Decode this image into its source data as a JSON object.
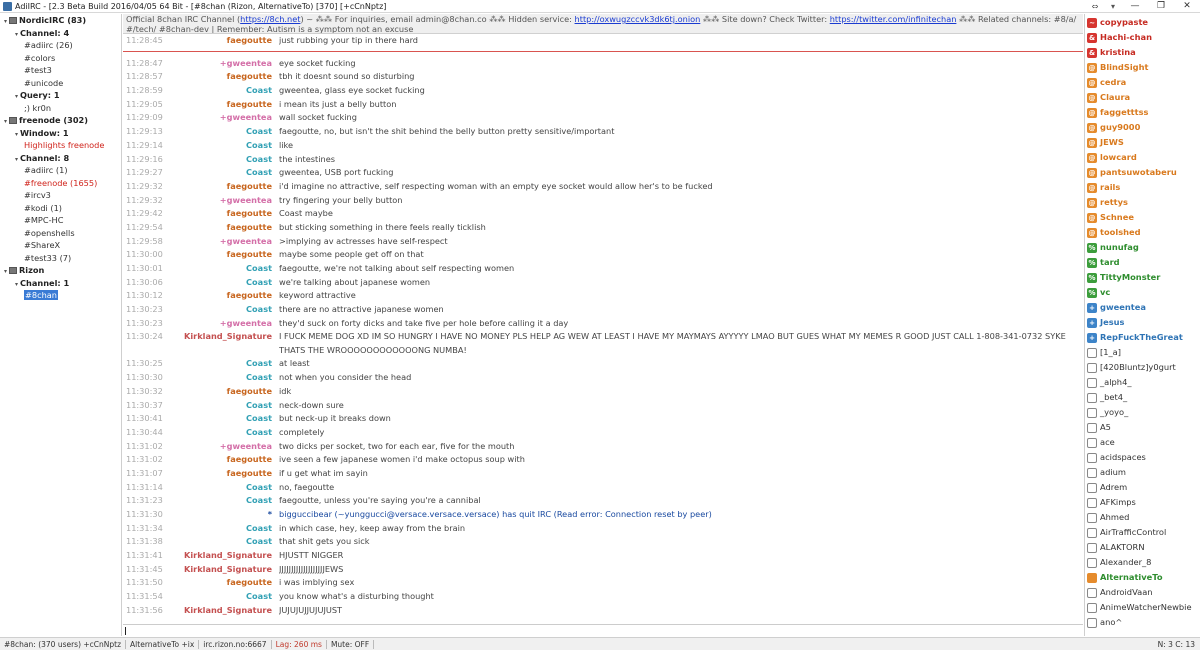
{
  "window": {
    "title": "AdiIRC - [2.3 Beta Build 2016/04/05 64 Bit - [#8chan (Rizon, AlternativeTo) [370] [+cCnNptz]",
    "buttons": [
      "⇔",
      "▾",
      "—",
      "❐",
      "✕"
    ]
  },
  "tree": [
    {
      "type": "server",
      "label": "NordicIRC (83)",
      "depth": 0
    },
    {
      "type": "group",
      "label": "Channel: 4",
      "depth": 1
    },
    {
      "type": "chan",
      "label": "#adiirc (26)",
      "depth": 2,
      "style": "ch"
    },
    {
      "type": "chan",
      "label": "#colors",
      "depth": 2,
      "style": "ch"
    },
    {
      "type": "chan",
      "label": "#test3",
      "depth": 2,
      "style": "ch"
    },
    {
      "type": "chan",
      "label": "#unicode",
      "depth": 2,
      "style": "ch"
    },
    {
      "type": "group",
      "label": "Query: 1",
      "depth": 1
    },
    {
      "type": "chan",
      "label": ";) kr0n",
      "depth": 2,
      "style": "ch"
    },
    {
      "type": "server",
      "label": "freenode (302)",
      "depth": 0
    },
    {
      "type": "group",
      "label": "Window: 1",
      "depth": 1
    },
    {
      "type": "chan",
      "label": "Highlights freenode",
      "depth": 2,
      "style": "red"
    },
    {
      "type": "group",
      "label": "Channel: 8",
      "depth": 1
    },
    {
      "type": "chan",
      "label": "#adiirc (1)",
      "depth": 2,
      "style": "ch"
    },
    {
      "type": "chan",
      "label": "#freenode (1655)",
      "depth": 2,
      "style": "red"
    },
    {
      "type": "chan",
      "label": "#ircv3",
      "depth": 2,
      "style": "ch"
    },
    {
      "type": "chan",
      "label": "#kodi (1)",
      "depth": 2,
      "style": "ch"
    },
    {
      "type": "chan",
      "label": "#MPC-HC",
      "depth": 2,
      "style": "ch"
    },
    {
      "type": "chan",
      "label": "#openshells",
      "depth": 2,
      "style": "ch"
    },
    {
      "type": "chan",
      "label": "#ShareX",
      "depth": 2,
      "style": "ch"
    },
    {
      "type": "chan",
      "label": "#test33 (7)",
      "depth": 2,
      "style": "ch"
    },
    {
      "type": "server",
      "label": "Rizon",
      "depth": 0
    },
    {
      "type": "group",
      "label": "Channel: 1",
      "depth": 1
    },
    {
      "type": "chan",
      "label": "#8chan",
      "depth": 2,
      "style": "sel"
    }
  ],
  "topic": {
    "p1": "Official 8chan IRC Channel (",
    "link1": "https://8ch.net",
    "p2": ") ~ ⁂⁂ For inquiries, email admin@8chan.co ⁂⁂ Hidden service: ",
    "link2": "http://oxwugzccvk3dk6tj.onion",
    "p3": " ⁂⁂ Site down? Check Twitter: ",
    "link3": "https://twitter.com/infinitechan",
    "p4": " ⁂⁂ Related channels: #8/a/ #/tech/ #8chan-dev | Remember: Autism is a symptom not an excuse"
  },
  "first_line": {
    "ts": "11:28:45",
    "nick": "faegoutte",
    "cls": "faegoutte",
    "msg": "just rubbing your tip in there hard"
  },
  "messages": [
    {
      "ts": "11:28:47",
      "nick": "+gweentea",
      "cls": "gweentea",
      "msg": "eye socket fucking"
    },
    {
      "ts": "11:28:57",
      "nick": "faegoutte",
      "cls": "faegoutte",
      "msg": "tbh it doesnt sound so disturbing"
    },
    {
      "ts": "11:28:59",
      "nick": "Coast",
      "cls": "coast",
      "msg": "gweentea, glass eye socket fucking"
    },
    {
      "ts": "11:29:05",
      "nick": "faegoutte",
      "cls": "faegoutte",
      "msg": "i mean its just a belly button"
    },
    {
      "ts": "11:29:09",
      "nick": "+gweentea",
      "cls": "gweentea",
      "msg": "wall socket fucking"
    },
    {
      "ts": "11:29:13",
      "nick": "Coast",
      "cls": "coast",
      "msg": "faegoutte, no, but isn't the shit behind the belly button pretty sensitive/important"
    },
    {
      "ts": "11:29:14",
      "nick": "Coast",
      "cls": "coast",
      "msg": "like"
    },
    {
      "ts": "11:29:16",
      "nick": "Coast",
      "cls": "coast",
      "msg": "the intestines"
    },
    {
      "ts": "11:29:27",
      "nick": "Coast",
      "cls": "coast",
      "msg": "gweentea, USB port fucking"
    },
    {
      "ts": "11:29:32",
      "nick": "faegoutte",
      "cls": "faegoutte",
      "msg": "i'd imagine no attractive, self respecting woman with an empty eye socket would allow her's to be fucked"
    },
    {
      "ts": "11:29:32",
      "nick": "+gweentea",
      "cls": "gweentea",
      "msg": "try fingering your belly button"
    },
    {
      "ts": "11:29:42",
      "nick": "faegoutte",
      "cls": "faegoutte",
      "msg": "Coast maybe"
    },
    {
      "ts": "11:29:54",
      "nick": "faegoutte",
      "cls": "faegoutte",
      "msg": "but sticking something in there feels really ticklish"
    },
    {
      "ts": "11:29:58",
      "nick": "+gweentea",
      "cls": "gweentea",
      "msg": ">implying av actresses have self-respect"
    },
    {
      "ts": "11:30:00",
      "nick": "faegoutte",
      "cls": "faegoutte",
      "msg": "maybe some people get off on that"
    },
    {
      "ts": "11:30:01",
      "nick": "Coast",
      "cls": "coast",
      "msg": "faegoutte, we're not talking about self respecting women"
    },
    {
      "ts": "11:30:06",
      "nick": "Coast",
      "cls": "coast",
      "msg": "we're talking about japanese women"
    },
    {
      "ts": "11:30:12",
      "nick": "faegoutte",
      "cls": "faegoutte",
      "msg": "keyword attractive"
    },
    {
      "ts": "11:30:23",
      "nick": "Coast",
      "cls": "coast",
      "msg": "there are no attractive japanese women"
    },
    {
      "ts": "11:30:23",
      "nick": "+gweentea",
      "cls": "gweentea",
      "msg": "they'd suck on forty dicks and take five per hole before calling it a day"
    },
    {
      "ts": "11:30:24",
      "nick": "Kirkland_Signature",
      "cls": "kirkland",
      "msg": "I FUCK MEME DOG XD IM SO HUNGRY I HAVE NO MONEY PLS HELP AG WEW AT LEAST I HAVE MY MAYMAYS AYYYYY LMAO BUT GUES WHAT MY MEMES R GOOD JUST CALL 1-808-341-0732 SYKE THATS THE WROOOOOOOOOOOONG NUMBA!",
      "tall": true
    },
    {
      "ts": "11:30:25",
      "nick": "Coast",
      "cls": "coast",
      "msg": "at least"
    },
    {
      "ts": "11:30:30",
      "nick": "Coast",
      "cls": "coast",
      "msg": "not when you consider the head"
    },
    {
      "ts": "11:30:32",
      "nick": "faegoutte",
      "cls": "faegoutte",
      "msg": "idk"
    },
    {
      "ts": "11:30:37",
      "nick": "Coast",
      "cls": "coast",
      "msg": "neck-down sure"
    },
    {
      "ts": "11:30:41",
      "nick": "Coast",
      "cls": "coast",
      "msg": "but neck-up it breaks down"
    },
    {
      "ts": "11:30:44",
      "nick": "Coast",
      "cls": "coast",
      "msg": "completely"
    },
    {
      "ts": "11:31:02",
      "nick": "+gweentea",
      "cls": "gweentea",
      "msg": "two dicks per socket, two for each ear, five for the mouth"
    },
    {
      "ts": "11:31:02",
      "nick": "faegoutte",
      "cls": "faegoutte",
      "msg": "ive seen a few japanese women i'd make octopus soup with"
    },
    {
      "ts": "11:31:07",
      "nick": "faegoutte",
      "cls": "faegoutte",
      "msg": "if u get what im sayin"
    },
    {
      "ts": "11:31:14",
      "nick": "Coast",
      "cls": "coast",
      "msg": "no, faegoutte"
    },
    {
      "ts": "11:31:23",
      "nick": "Coast",
      "cls": "coast",
      "msg": "faegoutte, unless you're saying you're a cannibal"
    },
    {
      "ts": "11:31:30",
      "nick": "*",
      "cls": "sys",
      "msg": "bigguccibear (~yunggucci@versace.versace.versace) has quit IRC (Read error: Connection reset by peer)",
      "sys": true
    },
    {
      "ts": "11:31:34",
      "nick": "Coast",
      "cls": "coast",
      "msg": "in which case, hey, keep away from the brain"
    },
    {
      "ts": "11:31:38",
      "nick": "Coast",
      "cls": "coast",
      "msg": "that shit gets you sick"
    },
    {
      "ts": "11:31:41",
      "nick": "Kirkland_Signature",
      "cls": "kirkland",
      "msg": "HJUSTT NIGGER"
    },
    {
      "ts": "11:31:45",
      "nick": "Kirkland_Signature",
      "cls": "kirkland",
      "msg": "JJJJJJJJJJJJJJJJJJJEWS"
    },
    {
      "ts": "11:31:50",
      "nick": "faegoutte",
      "cls": "faegoutte",
      "msg": "i was imblying sex"
    },
    {
      "ts": "11:31:54",
      "nick": "Coast",
      "cls": "coast",
      "msg": "you know what's a disturbing thought"
    },
    {
      "ts": "11:31:56",
      "nick": "Kirkland_Signature",
      "cls": "kirkland",
      "msg": "JUJUJUJJUJUJUST"
    }
  ],
  "nicklist": [
    {
      "mode": "q",
      "sym": "~",
      "name": "copypaste"
    },
    {
      "mode": "a",
      "sym": "&",
      "name": "Hachi-chan"
    },
    {
      "mode": "a",
      "sym": "&",
      "name": "kristina"
    },
    {
      "mode": "o",
      "sym": "@",
      "name": "BlindSight"
    },
    {
      "mode": "o",
      "sym": "@",
      "name": "cedra"
    },
    {
      "mode": "o",
      "sym": "@",
      "name": "Claura"
    },
    {
      "mode": "o",
      "sym": "@",
      "name": "faggetttss"
    },
    {
      "mode": "o",
      "sym": "@",
      "name": "guy9000"
    },
    {
      "mode": "o",
      "sym": "@",
      "name": "JEWS"
    },
    {
      "mode": "o",
      "sym": "@",
      "name": "lowcard"
    },
    {
      "mode": "o",
      "sym": "@",
      "name": "pantsuwotaberu"
    },
    {
      "mode": "o",
      "sym": "@",
      "name": "rails"
    },
    {
      "mode": "o",
      "sym": "@",
      "name": "rettys"
    },
    {
      "mode": "o",
      "sym": "@",
      "name": "Schnee"
    },
    {
      "mode": "o",
      "sym": "@",
      "name": "toolshed"
    },
    {
      "mode": "h",
      "sym": "%",
      "name": "nunufag"
    },
    {
      "mode": "h",
      "sym": "%",
      "name": "tard"
    },
    {
      "mode": "h",
      "sym": "%",
      "name": "TittyMonster"
    },
    {
      "mode": "h",
      "sym": "%",
      "name": "vc"
    },
    {
      "mode": "v",
      "sym": "+",
      "name": "gweentea"
    },
    {
      "mode": "v",
      "sym": "+",
      "name": "Jesus"
    },
    {
      "mode": "v",
      "sym": "+",
      "name": "RepFuckTheGreat"
    },
    {
      "mode": "n",
      "sym": "",
      "name": "[1_a]"
    },
    {
      "mode": "n",
      "sym": "",
      "name": "[420Bluntz]y0gurt"
    },
    {
      "mode": "n",
      "sym": "",
      "name": "_alph4_"
    },
    {
      "mode": "n",
      "sym": "",
      "name": "_bet4_"
    },
    {
      "mode": "n",
      "sym": "",
      "name": "_yoyo_"
    },
    {
      "mode": "n",
      "sym": "",
      "name": "A5"
    },
    {
      "mode": "n",
      "sym": "",
      "name": "ace"
    },
    {
      "mode": "n",
      "sym": "",
      "name": "acidspaces"
    },
    {
      "mode": "n",
      "sym": "",
      "name": "adium"
    },
    {
      "mode": "n",
      "sym": "",
      "name": "Adrem"
    },
    {
      "mode": "n",
      "sym": "",
      "name": "AFKimps"
    },
    {
      "mode": "n",
      "sym": "",
      "name": "Ahmed"
    },
    {
      "mode": "n",
      "sym": "",
      "name": "AirTrafficControl"
    },
    {
      "mode": "n",
      "sym": "",
      "name": "ALAKTORN"
    },
    {
      "mode": "n",
      "sym": "",
      "name": "Alexander_8"
    },
    {
      "mode": "special",
      "sym": "",
      "name": "AlternativeTo"
    },
    {
      "mode": "n",
      "sym": "",
      "name": "AndroidVaan"
    },
    {
      "mode": "n",
      "sym": "",
      "name": "AnimeWatcherNewbie"
    },
    {
      "mode": "n",
      "sym": "",
      "name": "ano^"
    }
  ],
  "status": {
    "channel": "#8chan: (370 users) +cCnNptz",
    "nick": "AlternativeTo +ix",
    "server": "irc.rizon.no:6667",
    "lag": "Lag: 260 ms",
    "mute": "Mute: OFF",
    "cursor": "N: 3 C: 13"
  },
  "colors": {
    "faegoutte": "#c8661f",
    "gweentea": "#d46fa8",
    "coast": "#33a1b5",
    "kirkland": "#c45050",
    "marker": "#d9534f",
    "selected": "#3a7bd5"
  }
}
